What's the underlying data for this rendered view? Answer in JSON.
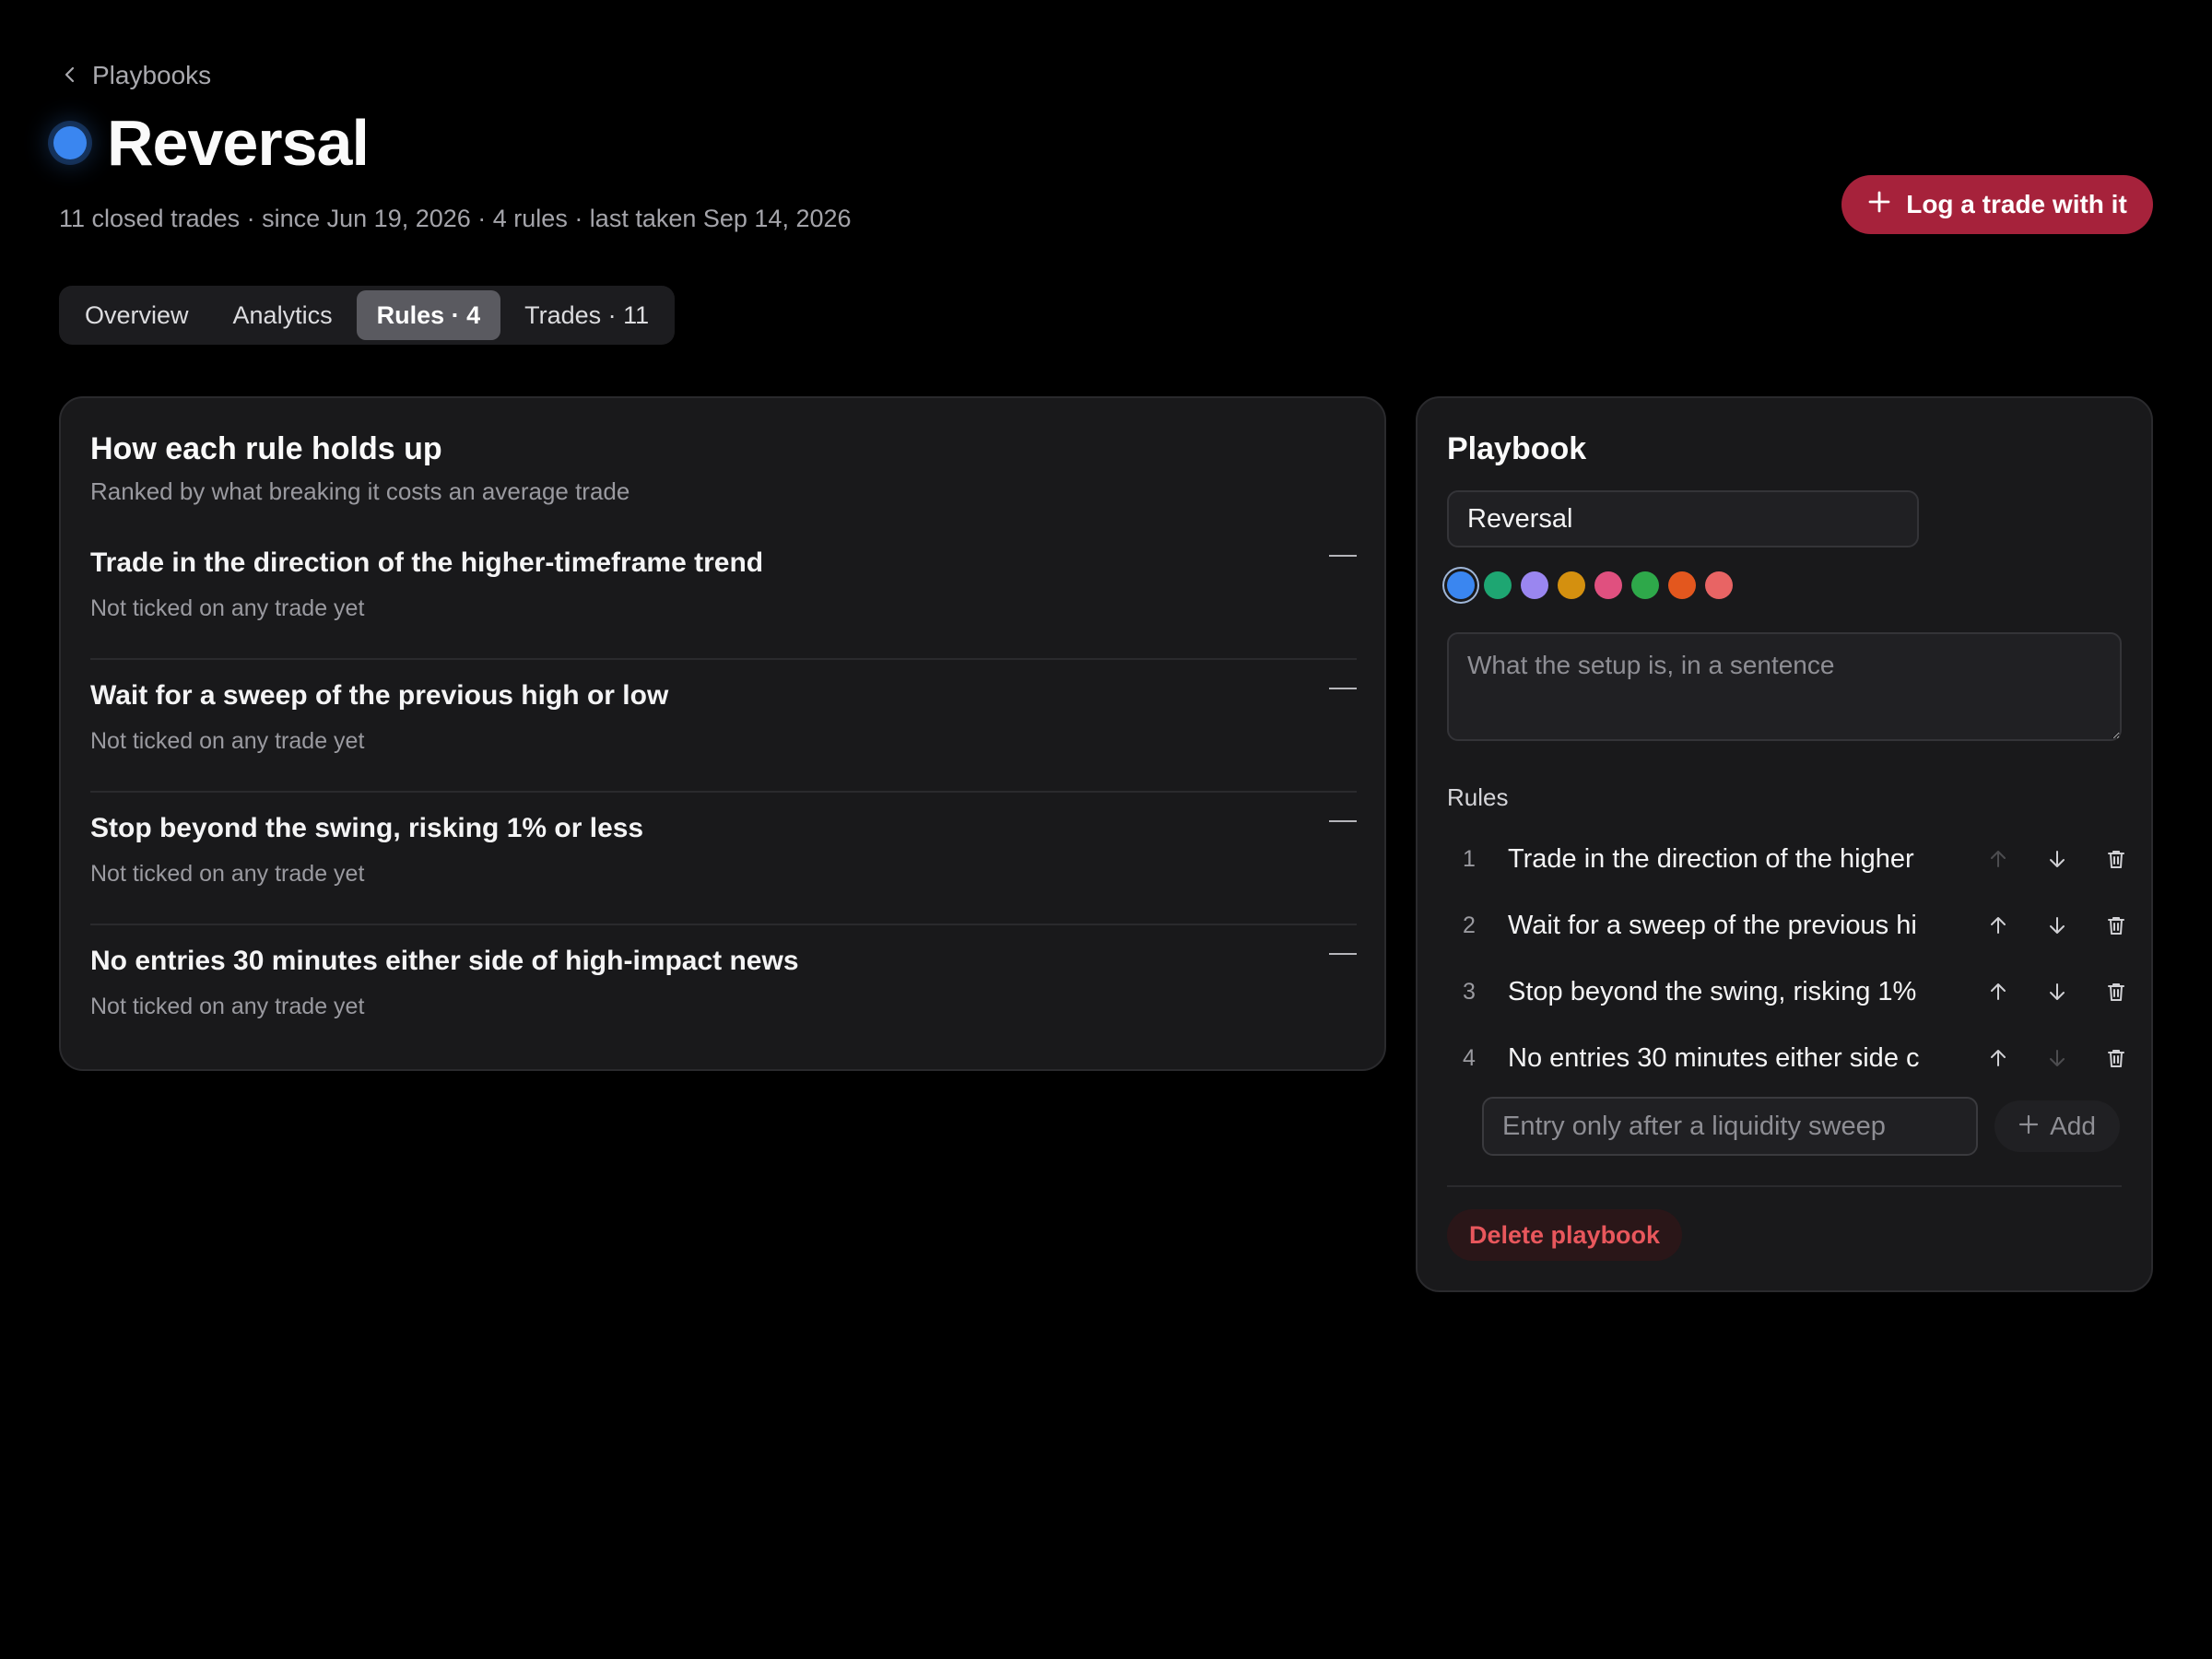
{
  "nav": {
    "back_label": "Playbooks"
  },
  "header": {
    "title": "Reversal",
    "dot_color": "#3a86f0",
    "subtitle": "11 closed trades · since Jun 19, 2026 · 4 rules · last taken Sep 14, 2026",
    "log_button": "Log a trade with it"
  },
  "tabs": [
    {
      "label": "Overview",
      "active": false
    },
    {
      "label": "Analytics",
      "active": false
    },
    {
      "label": "Rules · 4",
      "active": true
    },
    {
      "label": "Trades · 11",
      "active": false
    }
  ],
  "rule_analysis": {
    "title": "How each rule holds up",
    "subtitle": "Ranked by what breaking it costs an average trade",
    "rules": [
      {
        "name": "Trade in the direction of the higher-timeframe trend",
        "meta": "Not ticked on any trade yet"
      },
      {
        "name": "Wait for a sweep of the previous high or low",
        "meta": "Not ticked on any trade yet"
      },
      {
        "name": "Stop beyond the swing, risking 1% or less",
        "meta": "Not ticked on any trade yet"
      },
      {
        "name": "No entries 30 minutes either side of high-impact news",
        "meta": "Not ticked on any trade yet"
      }
    ]
  },
  "playbook": {
    "title": "Playbook",
    "name_value": "Reversal",
    "colors": [
      "#3a86f0",
      "#1ea672",
      "#9a86f0",
      "#d4900f",
      "#e0507f",
      "#2ea84a",
      "#e3571e",
      "#e86464"
    ],
    "selected_color": "#3a86f0",
    "description_placeholder": "What the setup is, in a sentence",
    "rules_label": "Rules",
    "rules": [
      {
        "num": "1",
        "text": "Trade in the direction of the higher"
      },
      {
        "num": "2",
        "text": "Wait for a sweep of the previous hi"
      },
      {
        "num": "3",
        "text": "Stop beyond the swing, risking 1%"
      },
      {
        "num": "4",
        "text": "No entries 30 minutes either side c"
      }
    ],
    "new_rule_placeholder": "Entry only after a liquidity sweep",
    "add_label": "Add",
    "delete_label": "Delete playbook"
  }
}
